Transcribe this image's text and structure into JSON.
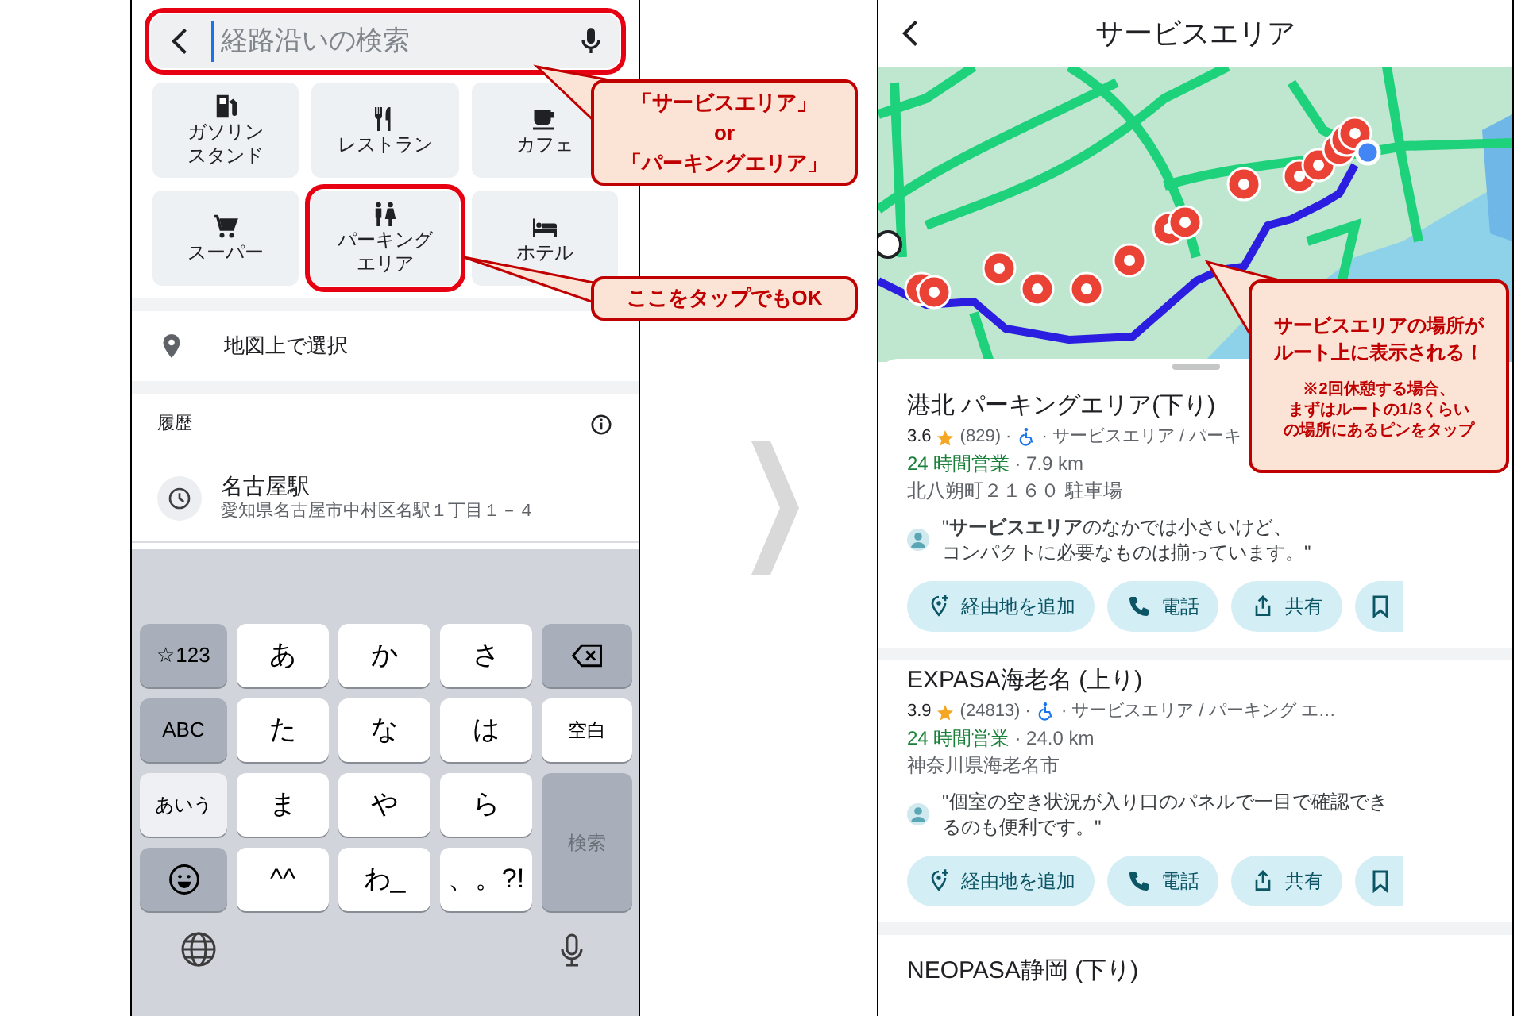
{
  "left_screen": {
    "search": {
      "placeholder": "経路沿いの検索",
      "highlighted": true
    },
    "categories": [
      {
        "label": [
          "ガソリン",
          "スタンド"
        ],
        "highlighted": false
      },
      {
        "label": [
          "レストラン"
        ],
        "highlighted": false
      },
      {
        "label": [
          "カフェ"
        ],
        "highlighted": false
      },
      {
        "label": [
          "スーパー"
        ],
        "highlighted": false
      },
      {
        "label": [
          "パーキング",
          "エリア"
        ],
        "highlighted": true
      },
      {
        "label": [
          "ホテル"
        ],
        "highlighted": false
      }
    ],
    "map_select": "地図上で選択",
    "history": {
      "heading": "履歴",
      "items": [
        {
          "name": "名古屋駅",
          "address": "愛知県名古屋市中村区名駅１丁目１－４"
        }
      ]
    },
    "keyboard": {
      "keys": [
        {
          "label": "☆123",
          "kind": "function"
        },
        {
          "label": "あ",
          "kind": "char"
        },
        {
          "label": "か",
          "kind": "char"
        },
        {
          "label": "さ",
          "kind": "char"
        },
        {
          "kind": "delete"
        },
        {
          "label": "ABC",
          "kind": "function"
        },
        {
          "label": "た",
          "kind": "char"
        },
        {
          "label": "な",
          "kind": "char"
        },
        {
          "label": "は",
          "kind": "char"
        },
        {
          "label": "空白",
          "kind": "space"
        },
        {
          "label": "あいう",
          "kind": "active"
        },
        {
          "label": "ま",
          "kind": "char"
        },
        {
          "label": "や",
          "kind": "char"
        },
        {
          "label": "ら",
          "kind": "char"
        },
        {
          "label": "検索",
          "kind": "enter",
          "disabled": true
        },
        {
          "kind": "emoji"
        },
        {
          "label": "^^",
          "kind": "char"
        },
        {
          "label": "わ_",
          "kind": "char"
        },
        {
          "label": "、。?!",
          "kind": "char"
        }
      ]
    }
  },
  "right_screen": {
    "title": "サービスエリア",
    "results": [
      {
        "name": "港北 パーキングエリア(下り)",
        "rating": "3.6",
        "reviews": "(829) ·",
        "category": "· サービスエリア / パーキ",
        "hours": "24 時間営業",
        "distance": "· 7.9 km",
        "address": "北八朔町２１６０ 駐車場",
        "review": [
          "\"**サービスエリア**のなかでは小さいけど、",
          "コンパクトに必要なものは揃っています。\""
        ],
        "actions": [
          "経由地を追加",
          "電話",
          "共有"
        ]
      },
      {
        "name": "EXPASA海老名 (上り)",
        "rating": "3.9",
        "reviews": "(24813) ·",
        "category": "· サービスエリア / パーキング エ…",
        "hours": "24 時間営業",
        "distance": "· 24.0 km",
        "address": "神奈川県海老名市",
        "review": [
          "\"個室の空き状況が入り口のパネルで一目で確認でき",
          "るのも便利です。\""
        ],
        "actions": [
          "経由地を追加",
          "電話",
          "共有"
        ]
      },
      {
        "name": "NEOPASA静岡 (下り)"
      }
    ]
  },
  "annotations": [
    {
      "text": [
        "「サービスエリア」",
        "or",
        "「パーキングエリア」"
      ]
    },
    {
      "text": [
        "ここをタップでもOK"
      ]
    },
    {
      "text": [
        "サービスエリアの場所が",
        "ルート上に表示される！"
      ],
      "note": [
        "※2回休憩する場合、",
        "まずはルートの1/3くらい",
        "の場所にあるピンをタップ"
      ]
    }
  ]
}
